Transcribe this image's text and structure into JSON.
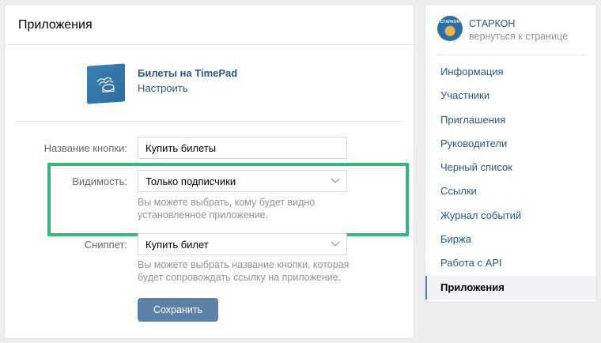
{
  "header": {
    "title": "Приложения"
  },
  "app": {
    "name": "Билеты на TimePad",
    "settings_link": "Настроить"
  },
  "form": {
    "button_name": {
      "label": "Название кнопки:",
      "value": "Купить билеты"
    },
    "visibility": {
      "label": "Видимость:",
      "value": "Только подписчики",
      "hint": "Вы можете выбрать, кому будет видно установленное приложение."
    },
    "snippet": {
      "label": "Сниппет:",
      "value": "Купить билет",
      "hint": "Вы можете выбрать название кнопки, которая будет сопровождать ссылку на приложение."
    },
    "save_label": "Сохранить"
  },
  "group": {
    "name": "СТАРКОН",
    "back_link": "вернуться к странице",
    "avatar_text": "СТАРКОН"
  },
  "sidebar": {
    "items": [
      {
        "label": "Информация"
      },
      {
        "label": "Участники"
      },
      {
        "label": "Приглашения"
      },
      {
        "label": "Руководители"
      },
      {
        "label": "Черный список"
      },
      {
        "label": "Ссылки"
      },
      {
        "label": "Журнал событий"
      },
      {
        "label": "Биржа"
      },
      {
        "label": "Работа с API"
      },
      {
        "label": "Приложения"
      }
    ],
    "active_index": 9
  },
  "colors": {
    "link": "#2a5885",
    "highlight": "#3bb57d",
    "button": "#5e81a8",
    "background": "#edeef0"
  },
  "icons": {
    "app_icon": "timepad-app-icon",
    "dropdown": "chevron-down-icon"
  }
}
